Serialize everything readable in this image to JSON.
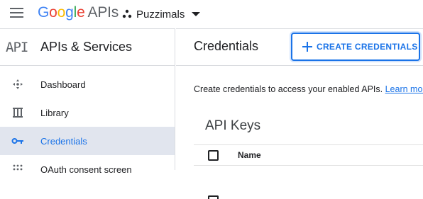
{
  "header": {
    "logo_letters": [
      "G",
      "o",
      "o",
      "g",
      "l",
      "e"
    ],
    "logo_suffix": "APIs",
    "project_name": "Puzzimals"
  },
  "sidebar": {
    "mark": "API",
    "title": "APIs & Services",
    "items": [
      {
        "label": "Dashboard",
        "icon": "dashboard-icon",
        "active": false
      },
      {
        "label": "Library",
        "icon": "library-icon",
        "active": false
      },
      {
        "label": "Credentials",
        "icon": "key-icon",
        "active": true
      },
      {
        "label": "OAuth consent screen",
        "icon": "oauth-icon",
        "active": false
      }
    ]
  },
  "main": {
    "title": "Credentials",
    "create_button_label": "CREATE CREDENTIALS",
    "intro_text": "Create credentials to access your enabled APIs.",
    "intro_link": "Learn more",
    "section_title": "API Keys",
    "table_columns": [
      "Name"
    ]
  },
  "colors": {
    "accent": "#1a73e8",
    "active_bg": "#e1e5ee"
  }
}
